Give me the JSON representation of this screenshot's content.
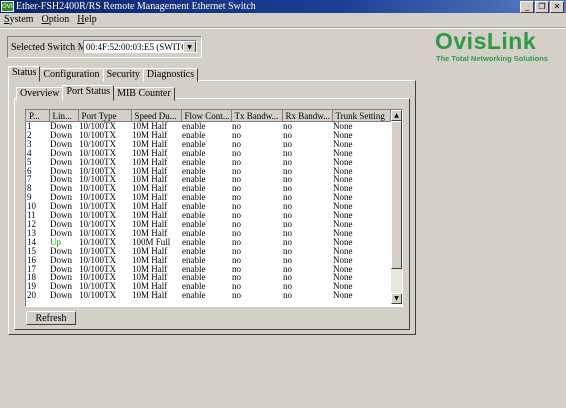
{
  "window": {
    "title": "Ether-FSH2400R/RS Remote Management Ethernet Switch",
    "icon_text": "OVIS",
    "minimize": "_",
    "restore": "❐",
    "close": "✕"
  },
  "menu": [
    "System",
    "Option",
    "Help"
  ],
  "mac": {
    "label": "Selected Switch Mac:",
    "value": "00:4F:52:00:03:E5 (SWITCH"
  },
  "logo": {
    "name": "OvisLink",
    "tagline": "The Total Networking Solutions"
  },
  "tabs": [
    "Status",
    "Configuration",
    "Security",
    "Diagnostics"
  ],
  "subtabs": [
    "Overview",
    "Port Status",
    "MIB Counter"
  ],
  "table": {
    "columns": [
      "P...",
      "Lin...",
      "Port Type",
      "Speed Du...",
      "Flow Cont...",
      "Tx Bandw...",
      "Rx Bandw...",
      "Trunk Setting"
    ],
    "rows": [
      [
        "1",
        "Down",
        "10/100TX",
        "10M Half",
        "enable",
        "no",
        "no",
        "None"
      ],
      [
        "2",
        "Down",
        "10/100TX",
        "10M Half",
        "enable",
        "no",
        "no",
        "None"
      ],
      [
        "3",
        "Down",
        "10/100TX",
        "10M Half",
        "enable",
        "no",
        "no",
        "None"
      ],
      [
        "4",
        "Down",
        "10/100TX",
        "10M Half",
        "enable",
        "no",
        "no",
        "None"
      ],
      [
        "5",
        "Down",
        "10/100TX",
        "10M Half",
        "enable",
        "no",
        "no",
        "None"
      ],
      [
        "6",
        "Down",
        "10/100TX",
        "10M Half",
        "enable",
        "no",
        "no",
        "None"
      ],
      [
        "7",
        "Down",
        "10/100TX",
        "10M Half",
        "enable",
        "no",
        "no",
        "None"
      ],
      [
        "8",
        "Down",
        "10/100TX",
        "10M Half",
        "enable",
        "no",
        "no",
        "None"
      ],
      [
        "9",
        "Down",
        "10/100TX",
        "10M Half",
        "enable",
        "no",
        "no",
        "None"
      ],
      [
        "10",
        "Down",
        "10/100TX",
        "10M Half",
        "enable",
        "no",
        "no",
        "None"
      ],
      [
        "11",
        "Down",
        "10/100TX",
        "10M Half",
        "enable",
        "no",
        "no",
        "None"
      ],
      [
        "12",
        "Down",
        "10/100TX",
        "10M Half",
        "enable",
        "no",
        "no",
        "None"
      ],
      [
        "13",
        "Down",
        "10/100TX",
        "10M Half",
        "enable",
        "no",
        "no",
        "None"
      ],
      [
        "14",
        "Up",
        "10/100TX",
        "100M Full",
        "enable",
        "no",
        "no",
        "None"
      ],
      [
        "15",
        "Down",
        "10/100TX",
        "10M Half",
        "enable",
        "no",
        "no",
        "None"
      ],
      [
        "16",
        "Down",
        "10/100TX",
        "10M Half",
        "enable",
        "no",
        "no",
        "None"
      ],
      [
        "17",
        "Down",
        "10/100TX",
        "10M Half",
        "enable",
        "no",
        "no",
        "None"
      ],
      [
        "18",
        "Down",
        "10/100TX",
        "10M Half",
        "enable",
        "no",
        "no",
        "None"
      ],
      [
        "19",
        "Down",
        "10/100TX",
        "10M Half",
        "enable",
        "no",
        "no",
        "None"
      ],
      [
        "20",
        "Down",
        "10/100TX",
        "10M Half",
        "enable",
        "no",
        "no",
        "None"
      ]
    ]
  },
  "refresh_label": "Refresh",
  "colors": {
    "titlebar": "#0a246a",
    "face": "#d4d0c8",
    "logo": "#2f9a45",
    "link_up": "#00a000"
  }
}
